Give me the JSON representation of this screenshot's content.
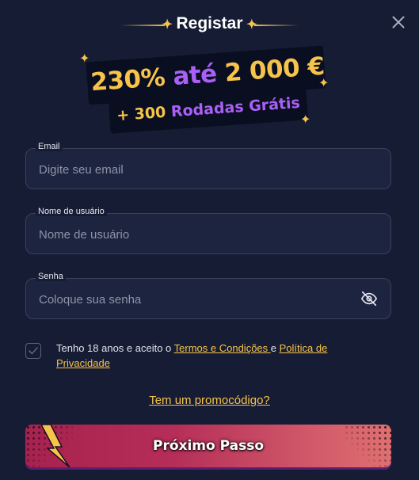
{
  "header": {
    "title": "Registar"
  },
  "promo": {
    "headline_amount": "230%",
    "headline_word": "até",
    "headline_value": "2 000 €",
    "sub_plus": "+ 300",
    "sub_text": "Rodadas Grátis"
  },
  "form": {
    "email": {
      "label": "Email",
      "placeholder": "Digite seu email"
    },
    "username": {
      "label": "Nome de usuário",
      "placeholder": "Nome de usuário"
    },
    "password": {
      "label": "Senha",
      "placeholder": "Coloque sua senha"
    }
  },
  "terms": {
    "prefix": "Tenho 18 anos e aceito o ",
    "terms_link": "Termos e Condições ",
    "middle": "e ",
    "privacy_link": "Política de Privacidade"
  },
  "promo_code_link": "Tem um promocódigo?",
  "next_button": "Próximo Passo",
  "colors": {
    "background": "#161c33",
    "accent_gold": "#f7c44b",
    "accent_purple": "#a960f5",
    "button_start": "#a8224f",
    "button_end": "#df7070"
  }
}
